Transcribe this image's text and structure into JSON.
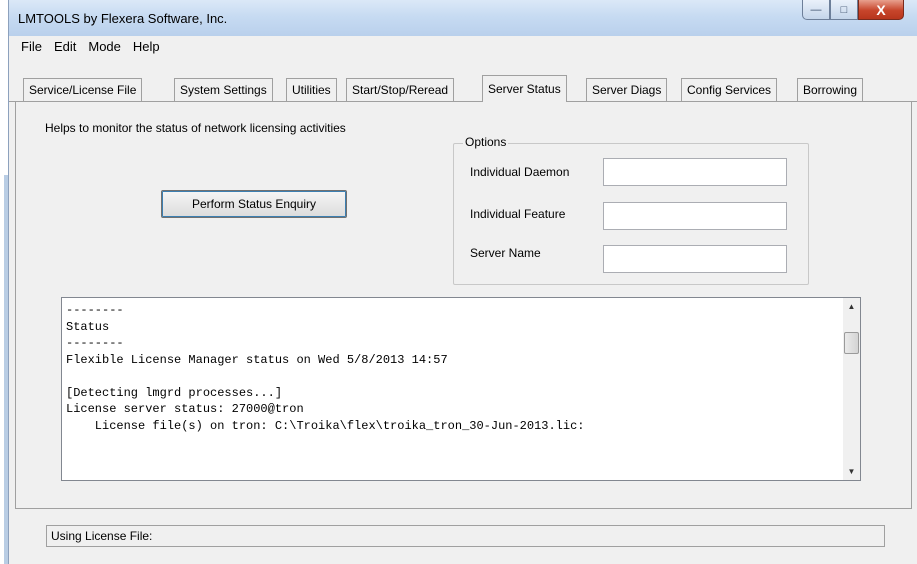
{
  "window": {
    "title": "LMTOOLS by Flexera Software, Inc.",
    "buttons": {
      "minimize": "—",
      "maximize": "□",
      "close": "X"
    }
  },
  "menu": [
    "File",
    "Edit",
    "Mode",
    "Help"
  ],
  "tabs": [
    {
      "label": "Service/License File",
      "active": false
    },
    {
      "label": "System Settings",
      "active": false
    },
    {
      "label": "Utilities",
      "active": false
    },
    {
      "label": "Start/Stop/Reread",
      "active": false
    },
    {
      "label": "Server Status",
      "active": true
    },
    {
      "label": "Server Diags",
      "active": false
    },
    {
      "label": "Config Services",
      "active": false
    },
    {
      "label": "Borrowing",
      "active": false
    }
  ],
  "panel": {
    "help_text": "Helps to monitor the status of network licensing activities",
    "perform_button": "Perform Status Enquiry",
    "options": {
      "label": "Options",
      "individual_daemon": {
        "label": "Individual Daemon",
        "value": ""
      },
      "individual_feature": {
        "label": "Individual Feature",
        "value": ""
      },
      "server_name": {
        "label": "Server Name",
        "value": ""
      }
    },
    "output_text": "--------\nStatus\n--------\nFlexible License Manager status on Wed 5/8/2013 14:57\n\n[Detecting lmgrd processes...]\nLicense server status: 27000@tron\n    License file(s) on tron: C:\\Troika\\flex\\troika_tron_30-Jun-2013.lic:"
  },
  "status_bar": {
    "text": "Using License File:"
  }
}
